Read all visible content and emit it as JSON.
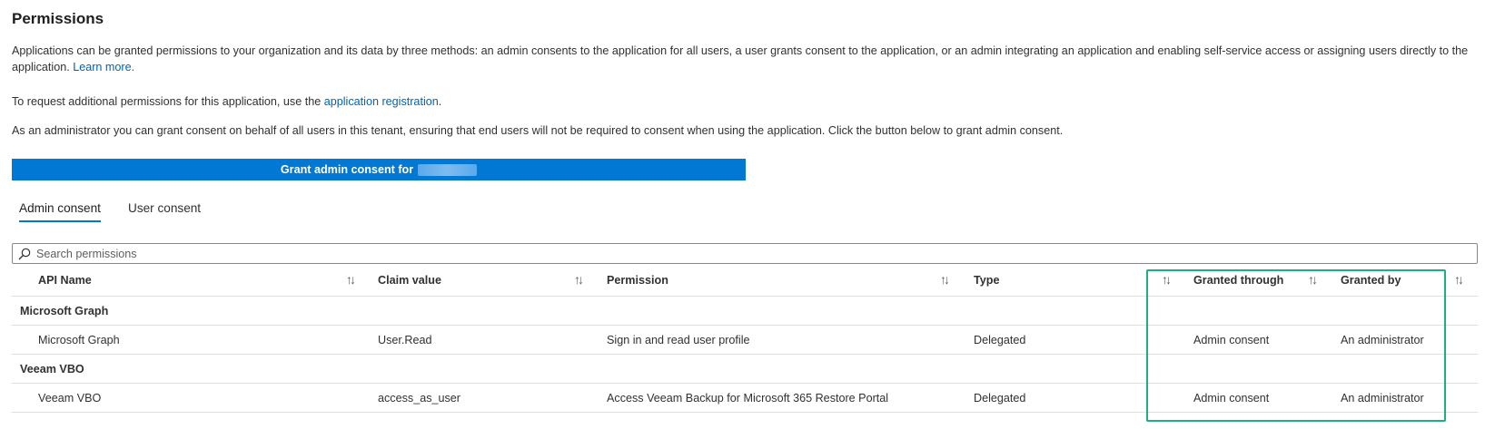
{
  "header": {
    "title": "Permissions"
  },
  "intro": {
    "text": "Applications can be granted permissions to your organization and its data by three methods: an admin consents to the application for all users, a user grants consent to the application, or an admin integrating an application and enabling self-service access or assigning users directly to the application.",
    "learn_more": "Learn more."
  },
  "request": {
    "prefix": "To request additional permissions for this application, use the",
    "link": "application registration",
    "suffix": "."
  },
  "admin_note": "As an administrator you can grant consent on behalf of all users in this tenant, ensuring that end users will not be required to consent when using the application. Click the button below to grant admin consent.",
  "grant_button": {
    "label": "Grant admin consent for"
  },
  "tabs": [
    {
      "label": "Admin consent",
      "active": true
    },
    {
      "label": "User consent",
      "active": false
    }
  ],
  "search": {
    "placeholder": "Search permissions",
    "value": ""
  },
  "table": {
    "columns": [
      "API Name",
      "Claim value",
      "Permission",
      "Type",
      "Granted through",
      "Granted by"
    ],
    "sort_glyph": "↑↓",
    "groups": [
      {
        "name": "Microsoft Graph",
        "rows": [
          {
            "api": "Microsoft Graph",
            "claim": "User.Read",
            "permission": "Sign in and read user profile",
            "type": "Delegated",
            "granted_through": "Admin consent",
            "granted_by": "An administrator"
          }
        ]
      },
      {
        "name": "Veeam VBO",
        "rows": [
          {
            "api": "Veeam VBO",
            "claim": "access_as_user",
            "permission": "Access Veeam Backup for Microsoft 365 Restore Portal",
            "type": "Delegated",
            "granted_through": "Admin consent",
            "granted_by": "An administrator"
          }
        ]
      }
    ]
  },
  "colors": {
    "accent": "#0078d4",
    "link": "#0063b1",
    "highlight_border": "#1fad83",
    "divider": "#e1dfdd"
  }
}
